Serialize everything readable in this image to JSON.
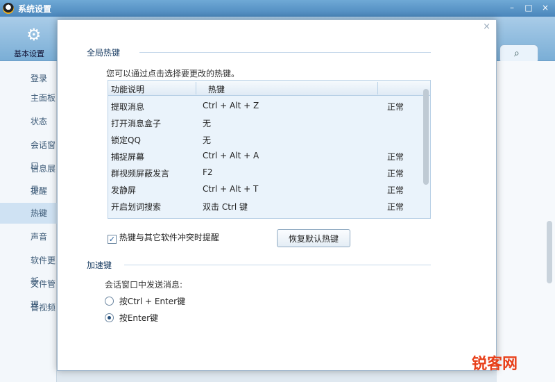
{
  "window": {
    "title": "系统设置",
    "controls": [
      "–",
      "□",
      "×"
    ]
  },
  "toolbar": {
    "basic_settings_label": "基本设置",
    "gear_icon": "gear-icon",
    "search_icon": "search-icon"
  },
  "sidebar": {
    "items": [
      {
        "label": "登录",
        "active": false
      },
      {
        "label": "主面板",
        "active": false
      },
      {
        "label": "状态",
        "active": false
      },
      {
        "label": "会话窗口",
        "active": false
      },
      {
        "label": "信息展示",
        "active": false
      },
      {
        "label": "提醒",
        "active": false
      },
      {
        "label": "热键",
        "active": true
      },
      {
        "label": "声音",
        "active": false
      },
      {
        "label": "软件更新",
        "active": false
      },
      {
        "label": "文件管理",
        "active": false
      },
      {
        "label": "音视频",
        "active": false
      }
    ]
  },
  "dialog": {
    "close": "×",
    "global_hotkeys": {
      "title": "全局热键",
      "hint": "您可以通过点击选择要更改的热键。",
      "columns": [
        "功能说明",
        "热键",
        ""
      ],
      "rows": [
        {
          "function": "提取消息",
          "hotkey": "Ctrl + Alt + Z",
          "status": "正常"
        },
        {
          "function": "打开消息盒子",
          "hotkey": "无",
          "status": ""
        },
        {
          "function": "锁定QQ",
          "hotkey": "无",
          "status": ""
        },
        {
          "function": "捕捉屏幕",
          "hotkey": "Ctrl + Alt + A",
          "status": "正常"
        },
        {
          "function": "群视频屏蔽发言",
          "hotkey": "F2",
          "status": "正常"
        },
        {
          "function": "发静屏",
          "hotkey": "Ctrl + Alt + T",
          "status": "正常"
        },
        {
          "function": "开启划词搜索",
          "hotkey": "双击 Ctrl 键",
          "status": "正常"
        }
      ],
      "conflict_checkbox_label": "热键与其它软件冲突时提醒",
      "conflict_checked": true,
      "restore_button_label": "恢复默认热键"
    },
    "accelerator": {
      "title": "加速键",
      "send_label": "会话窗口中发送消息:",
      "options": [
        {
          "label": "按Ctrl + Enter键",
          "selected": false
        },
        {
          "label": "按Enter键",
          "selected": true
        }
      ]
    }
  },
  "watermark": "锐客网"
}
